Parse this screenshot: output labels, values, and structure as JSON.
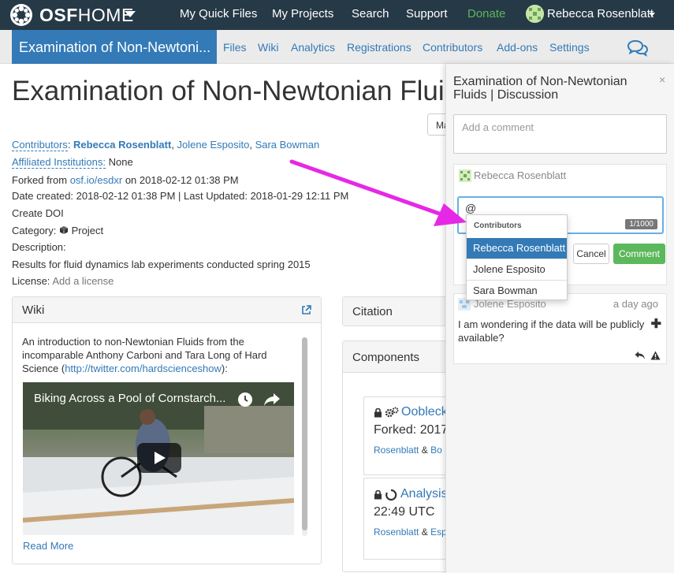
{
  "navbar": {
    "brand_osf": "OSF",
    "brand_home": "HOME",
    "links": [
      "My Quick Files",
      "My Projects",
      "Search",
      "Support"
    ],
    "donate": "Donate",
    "user": "Rebecca Rosenblatt"
  },
  "subnav": {
    "project_tab": "Examination of Non-Newtoni...",
    "links": [
      "Files",
      "Wiki",
      "Analytics",
      "Registrations",
      "Contributors",
      "Add-ons",
      "Settings"
    ]
  },
  "project": {
    "title": "Examination of Non-Newtonian Fluids",
    "partial_button": "Ma",
    "contributors_label": "Contributors",
    "contributors": [
      "Rebecca Rosenblatt",
      "Jolene Esposito",
      "Sara Bowman"
    ],
    "affiliated_label": "Affiliated Institutions:",
    "affiliated_value": "None",
    "forked_from_prefix": "Forked from",
    "forked_from_link": "osf.io/esdxr",
    "forked_from_suffix": "on 2018-02-12 01:38 PM",
    "dates": "Date created: 2018-02-12 01:38 PM | Last Updated: 2018-01-29 12:11 PM",
    "create_doi": "Create DOI",
    "category_label": "Category:",
    "category_value": "Project",
    "description_label": "Description:",
    "description": "Results for fluid dynamics lab experiments conducted spring 2015",
    "license_label": "License:",
    "license_value": "Add a license"
  },
  "wiki": {
    "title": "Wiki",
    "text_line1": "An introduction to non-Newtonian Fluids from the",
    "text_line2": "incomparable Anthony Carboni and Tara Long of Hard",
    "text_line3_prefix": "Science (",
    "text_link": "http://twitter.com/hardscienceshow",
    "text_line3_suffix": "):",
    "video_title": "Biking Across a Pool of Cornstarch...",
    "read_more": "Read More"
  },
  "citation": {
    "title": "Citation"
  },
  "components": {
    "title": "Components",
    "items": [
      {
        "name": "Oobleck",
        "sub": "Forked: 2017",
        "author1": "Rosenblatt",
        "sep": "&",
        "author2": "Bo"
      },
      {
        "name": "Analysis",
        "sub": "22:49 UTC",
        "author1": "Rosenblatt",
        "sep": "&",
        "author2": "Esp"
      }
    ]
  },
  "discussion": {
    "title": "Examination of Non-Newtonian Fluids | Discussion",
    "close": "×",
    "add_comment_placeholder": "Add a comment",
    "reply_author": "Rebecca Rosenblatt",
    "reply_value": "@",
    "counter": "1/1000",
    "cancel": "Cancel",
    "comment": "Comment",
    "comment_author": "Jolene Esposito",
    "comment_time": "a day ago",
    "comment_body": "I am wondering if the data will be publicly available?"
  },
  "mention_dropdown": {
    "heading": "Contributors",
    "items": [
      "Rebecca Rosenblatt",
      "Jolene Esposito",
      "Sara Bowman"
    ],
    "selected": "Rebecca Rosenblatt"
  },
  "colors": {
    "navbar_bg": "#263947",
    "primary": "#337ab7",
    "donate": "#5cb85c",
    "annotation_arrow": "#e628e6"
  }
}
